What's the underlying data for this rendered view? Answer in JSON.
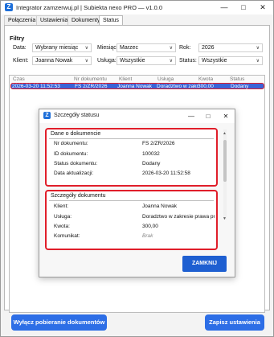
{
  "window": {
    "title": "Integrator zamzerwuj.pl | Subiekta nexo PRO — v1.0.0",
    "icon": "Z"
  },
  "tabs": [
    {
      "label": "Połączenia"
    },
    {
      "label": "Ustawienia"
    },
    {
      "label": "Dokumenty"
    },
    {
      "label": "Status"
    }
  ],
  "filters": {
    "title": "Filtry",
    "data_label": "Data:",
    "data_value": "Wybrany miesiąc",
    "miesiac_label": "Miesiąc:",
    "miesiac_value": "Marzec",
    "rok_label": "Rok:",
    "rok_value": "2026",
    "klient_label": "Klient:",
    "klient_value": "Joanna Nowak",
    "usluga_label": "Usługa:",
    "usluga_value": "Wszystkie",
    "status_label": "Status:",
    "status_value": "Wszystkie"
  },
  "table": {
    "columns": [
      "Czas",
      "Nr dokumentu",
      "Klient",
      "Usługa",
      "Kwota",
      "Status"
    ],
    "rows": [
      [
        "2026-03-20 11:52:53",
        "FS 2/ZR/2026",
        "Joanna Nowak",
        "Doradztwo w zakr",
        "300,00",
        "Dodany"
      ]
    ]
  },
  "buttons": {
    "disable_fetch": "Wyłącz pobieranie dokumentów",
    "save_settings": "Zapisz ustawienia"
  },
  "dialog": {
    "title": "Szczegóły statusu",
    "section1": {
      "title": "Dane o dokumencie",
      "items": [
        {
          "label": "Nr dokumentu:",
          "value": "FS 2/ZR/2026"
        },
        {
          "label": "ID dokumentu:",
          "value": "100032"
        },
        {
          "label": "Status dokumentu:",
          "value": "Dodany"
        },
        {
          "label": "Data aktualizacji:",
          "value": "2026-03-20 11:52:58"
        }
      ]
    },
    "section2": {
      "title": "Szczegóły dokumentu",
      "items": [
        {
          "label": "Klient:",
          "value": "Joanna Nowak"
        },
        {
          "label": "Usługa:",
          "value": "Doradztwo w zakresie prawa pra"
        },
        {
          "label": "Kwota:",
          "value": "300,00"
        },
        {
          "label": "Komunikat:",
          "value": "Brak"
        }
      ]
    },
    "close_button": "ZAMKNIJ"
  },
  "icons": {
    "app": "app-logo-icon",
    "minimize": "minimize-icon",
    "maximize": "maximize-icon",
    "close": "close-icon",
    "chevron": "chevron-down-icon"
  },
  "colors": {
    "accent": "#2d6ee6",
    "selection": "#3a63d8",
    "highlight_border": "#e01e2a"
  }
}
